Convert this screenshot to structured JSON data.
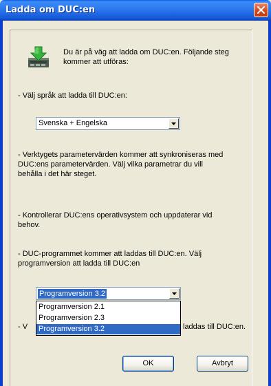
{
  "window": {
    "title": "Ladda om DUC:en"
  },
  "intro": {
    "line1": "Du är på väg att ladda om DUC:en. Följande steg",
    "line2": "kommer att utföras:"
  },
  "steps": {
    "language_label": "- Välj språk att ladda till DUC:en:",
    "language_value": "Svenska + Engelska",
    "params_line1": "- Verktygets parametervärden kommer att synkroniseras med",
    "params_line2": "DUC:ens parametervärden. Välj vilka parametrar du vill",
    "params_line3": "behålla i det här steget.",
    "os_line1": "- Kontrollerar DUC:ens operativsystem och uppdaterar vid",
    "os_line2": "behov.",
    "program_line1": "- DUC-programmet kommer att laddas till DUC:en. Välj",
    "program_line2": "programversion att ladda till DUC:en",
    "program_value": "Programversion 3.2",
    "hidden_prefix": "- V",
    "hidden_suffix": "laddas till DUC:en."
  },
  "dropdown": {
    "options": [
      "Programversion 2.1",
      "Programversion 2.3",
      "Programversion 3.2"
    ],
    "selected_index": 2
  },
  "buttons": {
    "ok": "OK",
    "cancel": "Avbryt"
  },
  "colors": {
    "titlebar": "#2e7bf0",
    "selection": "#316ac5",
    "close": "#d64b22"
  }
}
